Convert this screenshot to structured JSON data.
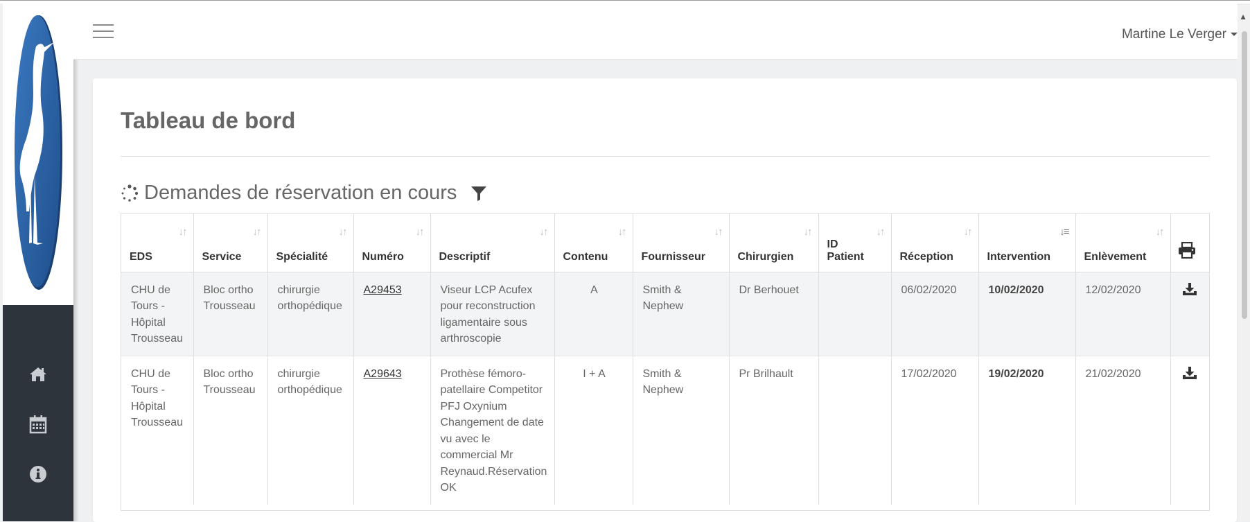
{
  "header": {
    "user_name": "Martine Le Verger"
  },
  "sidebar": {
    "nav_items": [
      {
        "icon": "home-icon"
      },
      {
        "icon": "calendar-icon"
      },
      {
        "icon": "info-icon"
      }
    ]
  },
  "page": {
    "title": "Tableau de bord",
    "section_title": "Demandes de réservation en cours"
  },
  "table": {
    "columns": [
      "EDS",
      "Service",
      "Spécialité",
      "Numéro",
      "Descriptif",
      "Contenu",
      "Fournisseur",
      "Chirurgien",
      "ID Patient",
      "Réception",
      "Intervention",
      "Enlèvement"
    ],
    "sorted_column": "Intervention",
    "rows": [
      {
        "eds": "CHU de Tours - Hôpital Trousseau",
        "service": "Bloc ortho Trousseau",
        "specialite": "chirurgie orthopédique",
        "numero": "A29453",
        "descriptif": "Viseur LCP Acufex pour reconstruction ligamentaire sous arthroscopie",
        "contenu": "A",
        "fournisseur": "Smith & Nephew",
        "chirurgien": "Dr Berhouet",
        "id_patient": "",
        "reception": "06/02/2020",
        "intervention": "10/02/2020",
        "enlevement": "12/02/2020"
      },
      {
        "eds": "CHU de Tours - Hôpital Trousseau",
        "service": "Bloc ortho Trousseau",
        "specialite": "chirurgie orthopédique",
        "numero": "A29643",
        "descriptif": "Prothèse fémoro-patellaire Competitor PFJ Oxynium Changement de date vu avec le commercial Mr Reynaud.Réservation OK",
        "contenu": "I + A",
        "fournisseur": "Smith & Nephew",
        "chirurgien": "Pr Brilhault",
        "id_patient": "",
        "reception": "17/02/2020",
        "intervention": "19/02/2020",
        "enlevement": "21/02/2020"
      }
    ]
  },
  "colors": {
    "sidebar_dark": "#2e343c",
    "logo_blue": "#2a64a8",
    "background": "#eef0f2"
  }
}
